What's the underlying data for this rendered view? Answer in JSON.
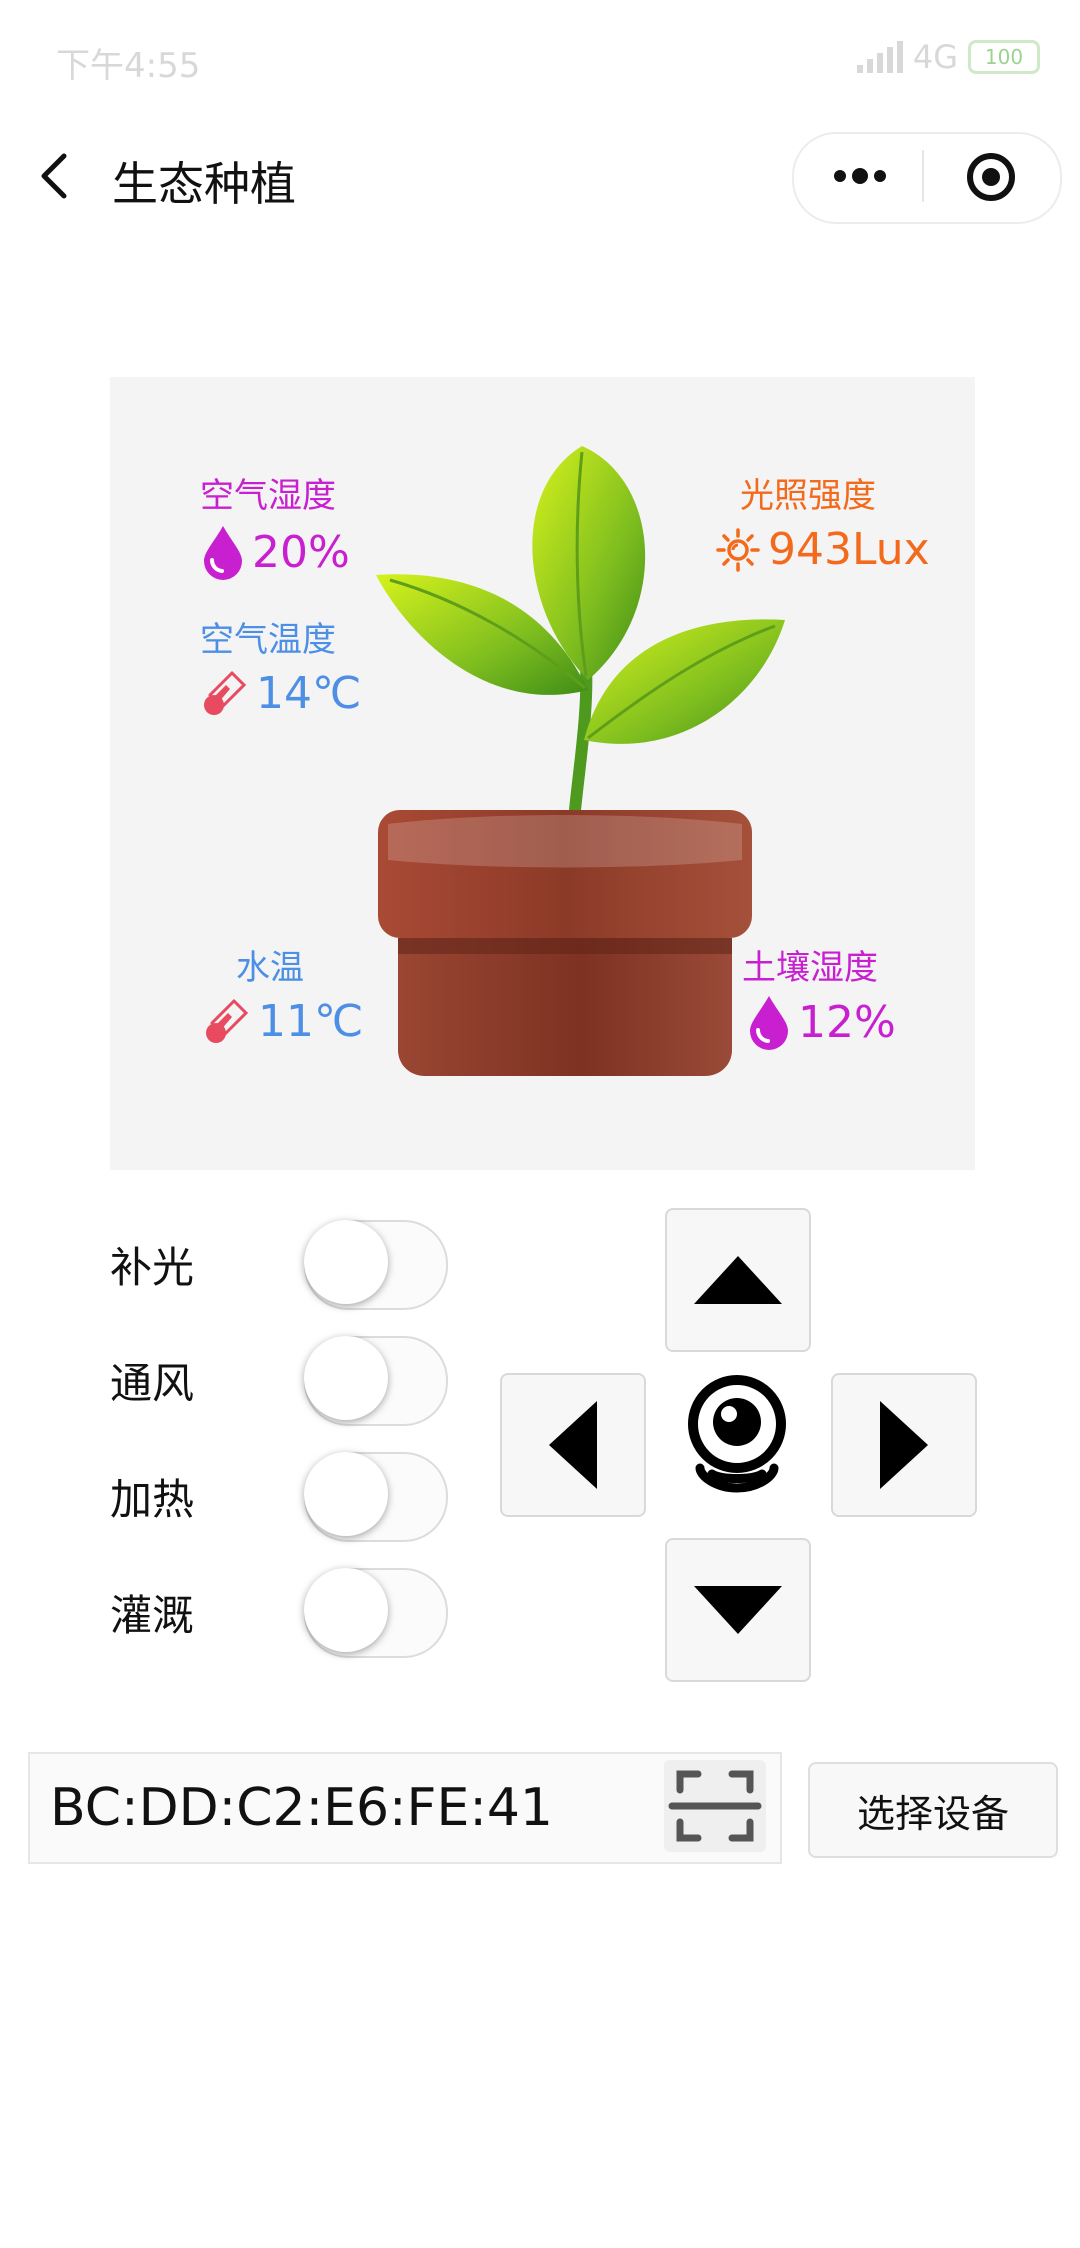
{
  "status_bar": {
    "time": "下午4:55",
    "network": "4G",
    "battery": "100"
  },
  "nav": {
    "title": "生态种植"
  },
  "sensors": {
    "air_humidity": {
      "label": "空气湿度",
      "value": "20%",
      "color": "#c81fd0"
    },
    "air_temperature": {
      "label": "空气温度",
      "value": "14℃",
      "color": "#4d8fe5"
    },
    "light": {
      "label": "光照强度",
      "value": "943Lux",
      "color": "#f36a1c"
    },
    "water_temperature": {
      "label": "水温",
      "value": "11℃",
      "color": "#4d8fe5"
    },
    "soil_humidity": {
      "label": "土壤湿度",
      "value": "12%",
      "color": "#c81fd0"
    }
  },
  "controls": {
    "switches": [
      {
        "label": "补光",
        "on": false
      },
      {
        "label": "通风",
        "on": false
      },
      {
        "label": "加热",
        "on": false
      },
      {
        "label": "灌溉",
        "on": false
      }
    ],
    "dpad": [
      "up-arrow-icon",
      "left-arrow-icon",
      "camera-icon",
      "right-arrow-icon",
      "down-arrow-icon"
    ]
  },
  "device": {
    "address": "BC:DD:C2:E6:FE:41",
    "select_label": "选择设备"
  }
}
